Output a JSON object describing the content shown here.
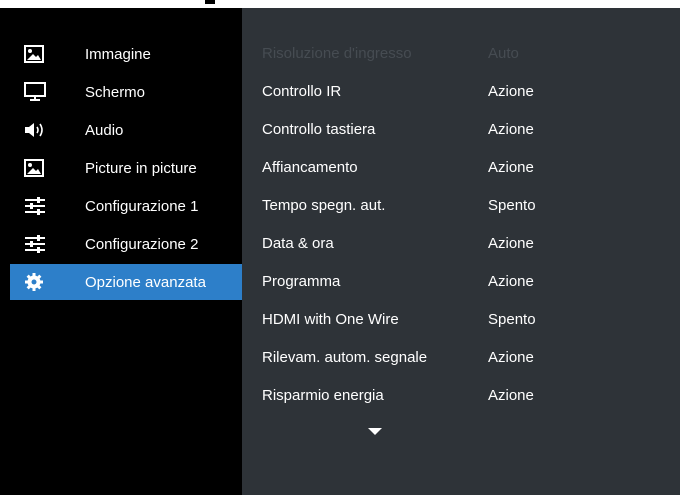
{
  "sidebar": {
    "items": [
      {
        "label": "Immagine",
        "icon": "picture-icon"
      },
      {
        "label": "Schermo",
        "icon": "monitor-icon"
      },
      {
        "label": "Audio",
        "icon": "speaker-icon"
      },
      {
        "label": "Picture in picture",
        "icon": "picture-icon"
      },
      {
        "label": "Configurazione 1",
        "icon": "sliders-icon"
      },
      {
        "label": "Configurazione 2",
        "icon": "sliders-icon"
      },
      {
        "label": "Opzione avanzata",
        "icon": "gear-icon"
      }
    ],
    "active_index": 6
  },
  "settings": {
    "rows": [
      {
        "label": "Risoluzione d'ingresso",
        "value": "Auto",
        "disabled": true
      },
      {
        "label": "Controllo IR",
        "value": "Azione"
      },
      {
        "label": "Controllo tastiera",
        "value": "Azione"
      },
      {
        "label": "Affiancamento",
        "value": "Azione"
      },
      {
        "label": "Tempo spegn. aut.",
        "value": "Spento"
      },
      {
        "label": "Data & ora",
        "value": "Azione"
      },
      {
        "label": "Programma",
        "value": "Azione"
      },
      {
        "label": "HDMI with One Wire",
        "value": "Spento"
      },
      {
        "label": "Rilevam. autom. segnale",
        "value": "Azione"
      },
      {
        "label": "Risparmio energia",
        "value": "Azione"
      }
    ],
    "more_icon": "chevron-down-icon"
  },
  "colors": {
    "left_bg": "#000000",
    "right_bg": "#2e3338",
    "accent": "#2d7fc9",
    "disabled_text": "#464c52"
  }
}
